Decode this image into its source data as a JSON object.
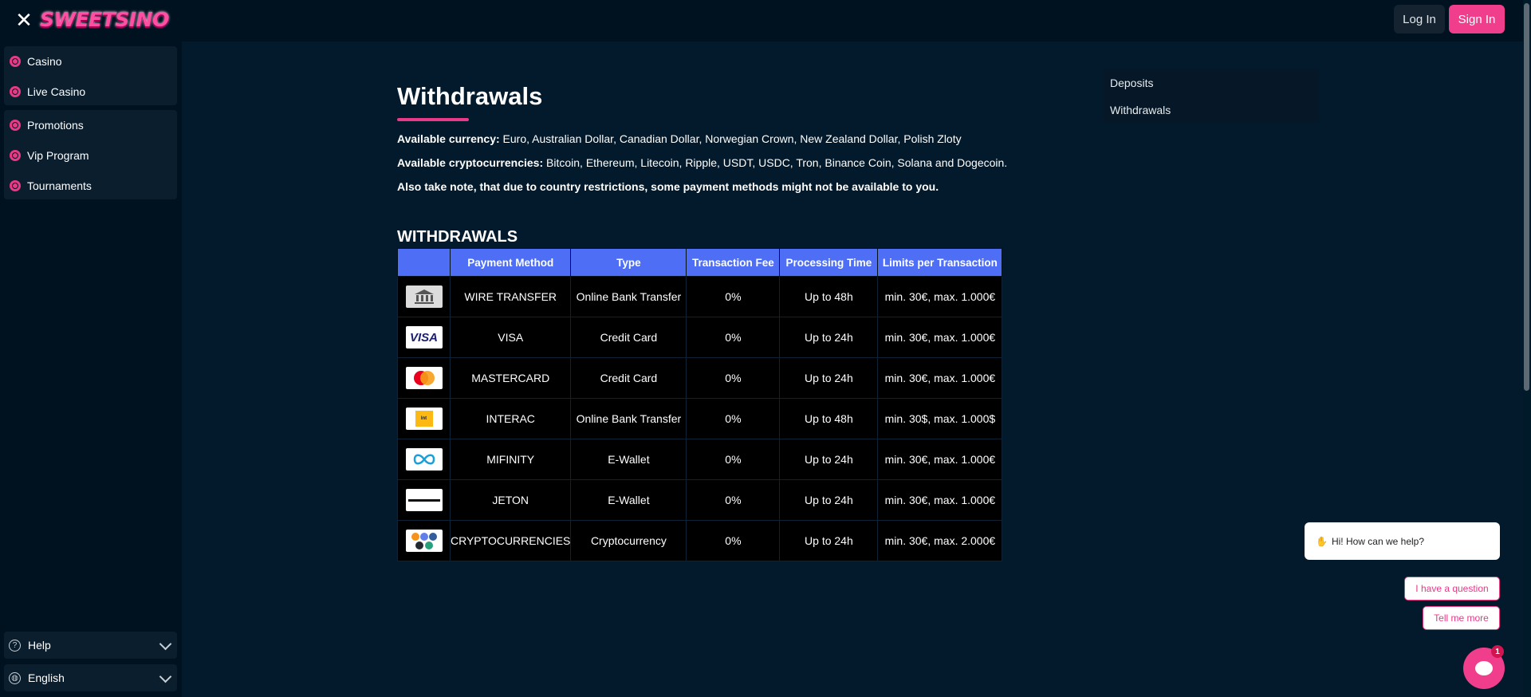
{
  "header": {
    "logo_text": "SWEETSINO",
    "login_label": "Log In",
    "signin_label": "Sign In"
  },
  "sidebar": {
    "group1": [
      {
        "label": "Casino",
        "icon": "casino-chip-icon"
      },
      {
        "label": "Live Casino",
        "icon": "live-casino-icon"
      }
    ],
    "group2": [
      {
        "label": "Promotions",
        "icon": "gift-icon"
      },
      {
        "label": "Vip Program",
        "icon": "crown-icon"
      },
      {
        "label": "Tournaments",
        "icon": "trophy-icon"
      }
    ],
    "help_label": "Help",
    "language_label": "English"
  },
  "main": {
    "title": "Withdrawals",
    "currency_label": "Available currency:",
    "currency_text": " Euro, Australian Dollar, Canadian Dollar, Norwegian Crown, New Zealand Dollar, Polish Zloty",
    "crypto_label": "Available cryptocurrencies:",
    "crypto_text": " Bitcoin, Ethereum, Litecoin, Ripple, USDT, USDC, Tron, Binance Coin, Solana and Dogecoin.",
    "note": "Also take note, that due to country restrictions, some payment methods might not be available to you.",
    "section_title": "WITHDRAWALS"
  },
  "toc": {
    "items": [
      "Deposits",
      "Withdrawals"
    ]
  },
  "table": {
    "headers": [
      "",
      "Payment Method",
      "Type",
      "Transaction Fee",
      "Processing Time",
      "Limits per Transaction"
    ],
    "rows": [
      {
        "logo": "bank-icon",
        "method": "WIRE TRANSFER",
        "type": "Online Bank Transfer",
        "fee": "0%",
        "time": "Up to 48h",
        "limits": "min. 30€, max. 1.000€"
      },
      {
        "logo": "visa-logo",
        "method": "VISA",
        "type": "Credit Card",
        "fee": "0%",
        "time": "Up to 24h",
        "limits": "min. 30€, max. 1.000€"
      },
      {
        "logo": "mastercard-logo",
        "method": "MASTERCARD",
        "type": "Credit Card",
        "fee": "0%",
        "time": "Up to 24h",
        "limits": "min. 30€, max. 1.000€"
      },
      {
        "logo": "interac-logo",
        "method": "INTERAC",
        "type": "Online Bank Transfer",
        "fee": "0%",
        "time": "Up to 48h",
        "limits": "min. 30$, max. 1.000$"
      },
      {
        "logo": "mifinity-logo",
        "method": "MIFINITY",
        "type": "E-Wallet",
        "fee": "0%",
        "time": "Up to 24h",
        "limits": "min. 30€, max. 1.000€"
      },
      {
        "logo": "jeton-logo",
        "method": "JETON",
        "type": "E-Wallet",
        "fee": "0%",
        "time": "Up to 24h",
        "limits": "min. 30€, max. 1.000€"
      },
      {
        "logo": "crypto-coins-logo",
        "method": "CRYPTOCURRENCIES",
        "type": "Cryptocurrency",
        "fee": "0%",
        "time": "Up to 24h",
        "limits": "min. 30€, max. 2.000€"
      }
    ]
  },
  "chat": {
    "greeting": "Hi! How can we help?",
    "option_a": "I have a question",
    "option_b": "Tell me more",
    "badge_count": "1"
  },
  "colors": {
    "accent": "#f03e8c",
    "table_header": "#4d6ef5",
    "background": "#021a2b"
  }
}
